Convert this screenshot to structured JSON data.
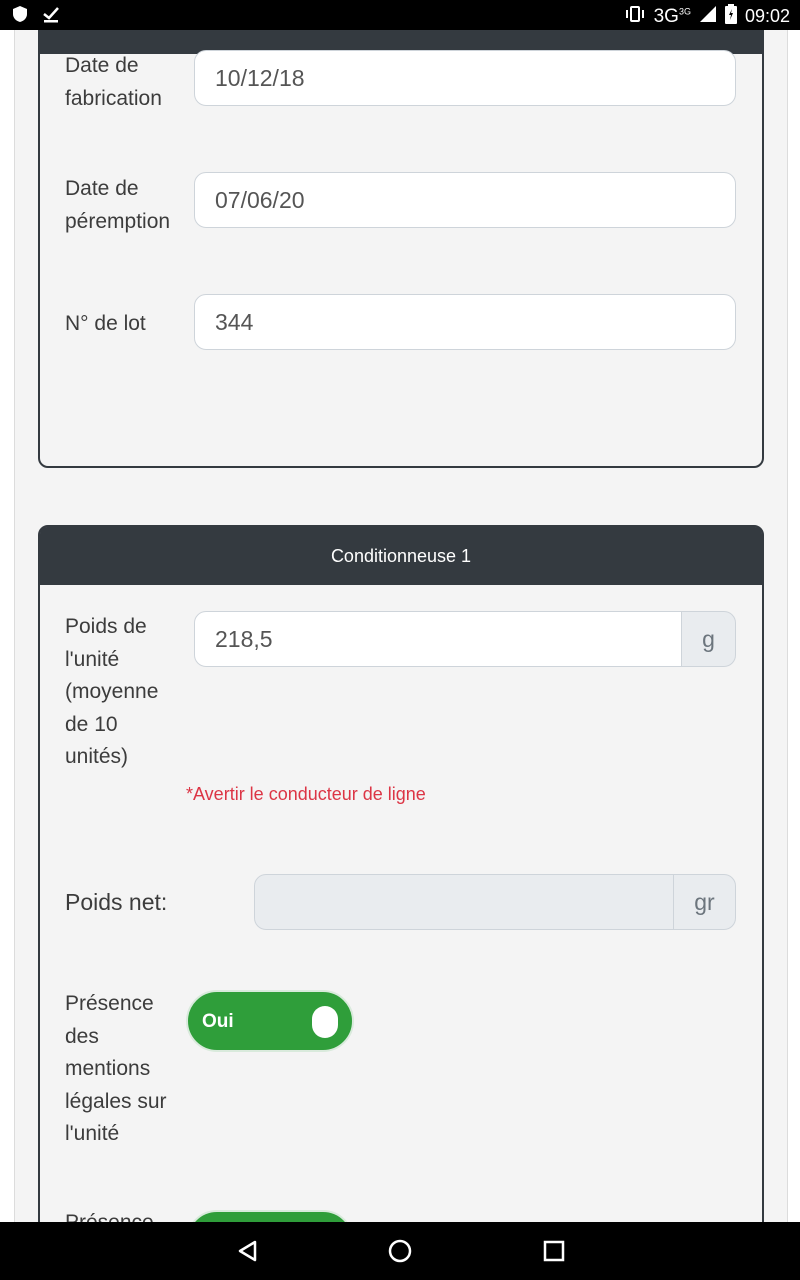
{
  "status_bar": {
    "network": "3G",
    "network_sup": "3G",
    "time": "09:02"
  },
  "card_production": {
    "fields": [
      {
        "label": "Date de fabrication",
        "value": "10/12/18"
      },
      {
        "label": "Date de péremption",
        "value": "07/06/20"
      },
      {
        "label": "N° de lot",
        "value": "344"
      }
    ]
  },
  "card_conditionneuse": {
    "title": "Conditionneuse 1",
    "poids_unite": {
      "label": "Poids de l'unité (moyenne de 10 unités)",
      "value": "218,5",
      "unit": "g",
      "warning": "*Avertir le conducteur de ligne"
    },
    "poids_net": {
      "label": "Poids net:",
      "value": "",
      "unit": "gr"
    },
    "mentions_legales": {
      "label": "Présence des mentions légales sur l'unité",
      "toggle_label": "Oui"
    },
    "next_field_label": "Présence"
  },
  "colors": {
    "header": "#343a40",
    "toggle_on": "#2f9e3a",
    "warning": "#dc3545"
  }
}
